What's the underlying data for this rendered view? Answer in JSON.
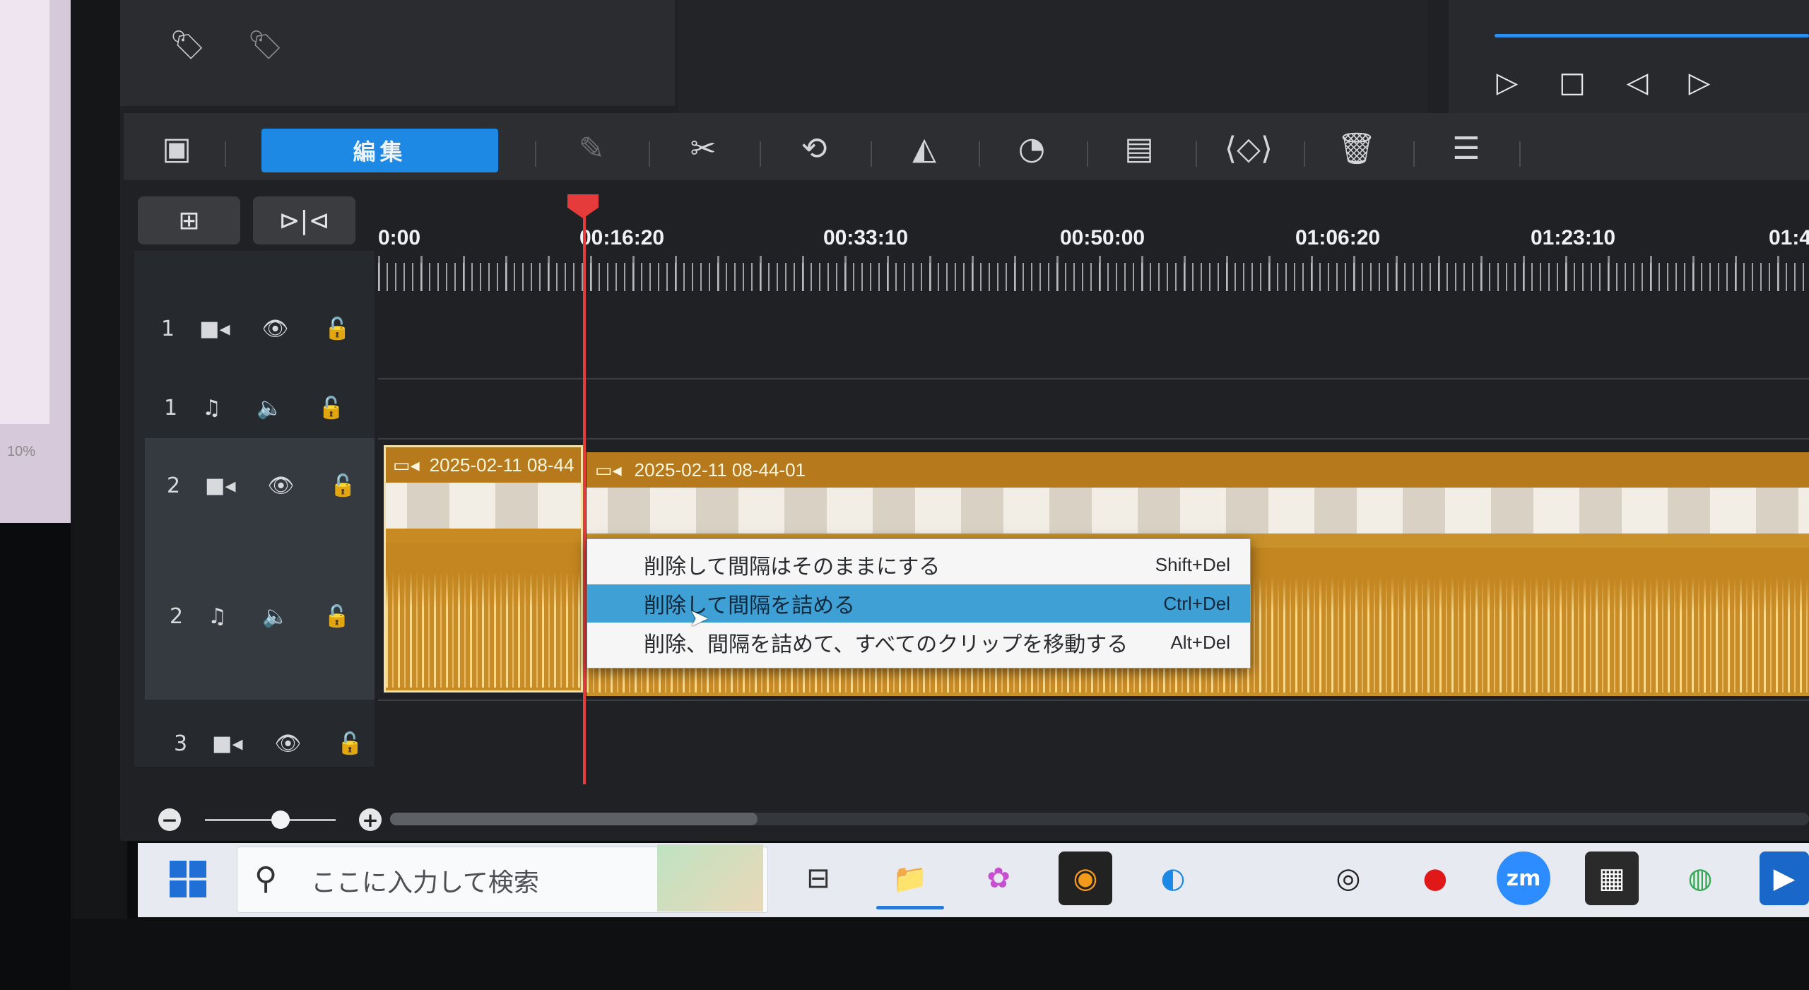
{
  "tags": {
    "add_tag_icon": "tag-plus-icon",
    "remove_tag_icon": "tag-minus-icon"
  },
  "preview": {
    "play_icon": "play-icon",
    "stop_icon": "stop-icon",
    "prev_frame_icon": "prev-frame-icon",
    "next_frame_icon": "next-frame-icon"
  },
  "toolbar": {
    "edit_tab": "編集",
    "tools": [
      "storyboard-icon",
      "pen-icon",
      "scissors-icon",
      "rotate-icon",
      "mirror-icon",
      "speed-icon",
      "voiceover-icon",
      "keyframe-icon",
      "trash-icon",
      "menu-icon"
    ]
  },
  "timeline": {
    "ruler": [
      "0:00",
      "00:16:20",
      "00:33:10",
      "00:50:00",
      "01:06:20",
      "01:23:10",
      "01:4"
    ],
    "tracks": [
      {
        "num": "1",
        "type": "video"
      },
      {
        "num": "1",
        "type": "audio"
      },
      {
        "num": "2",
        "type": "video"
      },
      {
        "num": "2",
        "type": "audio"
      },
      {
        "num": "3",
        "type": "video"
      }
    ],
    "clips": [
      {
        "title": "2025-02-11 08-44"
      },
      {
        "title": "2025-02-11 08-44-01"
      }
    ]
  },
  "context_menu": {
    "items": [
      {
        "label": "削除して間隔はそのままにする",
        "shortcut": "Shift+Del"
      },
      {
        "label": "削除して間隔を詰める",
        "shortcut": "Ctrl+Del"
      },
      {
        "label": "削除、間隔を詰めて、すべてのクリップを移動する",
        "shortcut": "Alt+Del"
      }
    ],
    "highlighted_index": 1
  },
  "left_window": {
    "zoom": "10%"
  },
  "taskbar": {
    "search_placeholder": "ここに入力して検索",
    "zoom_app_label": "zm"
  },
  "colors": {
    "accent": "#1e88e5",
    "playhead": "#e63b3b",
    "clip": "#c9912a",
    "menu_highlight": "#3fa0d6"
  }
}
